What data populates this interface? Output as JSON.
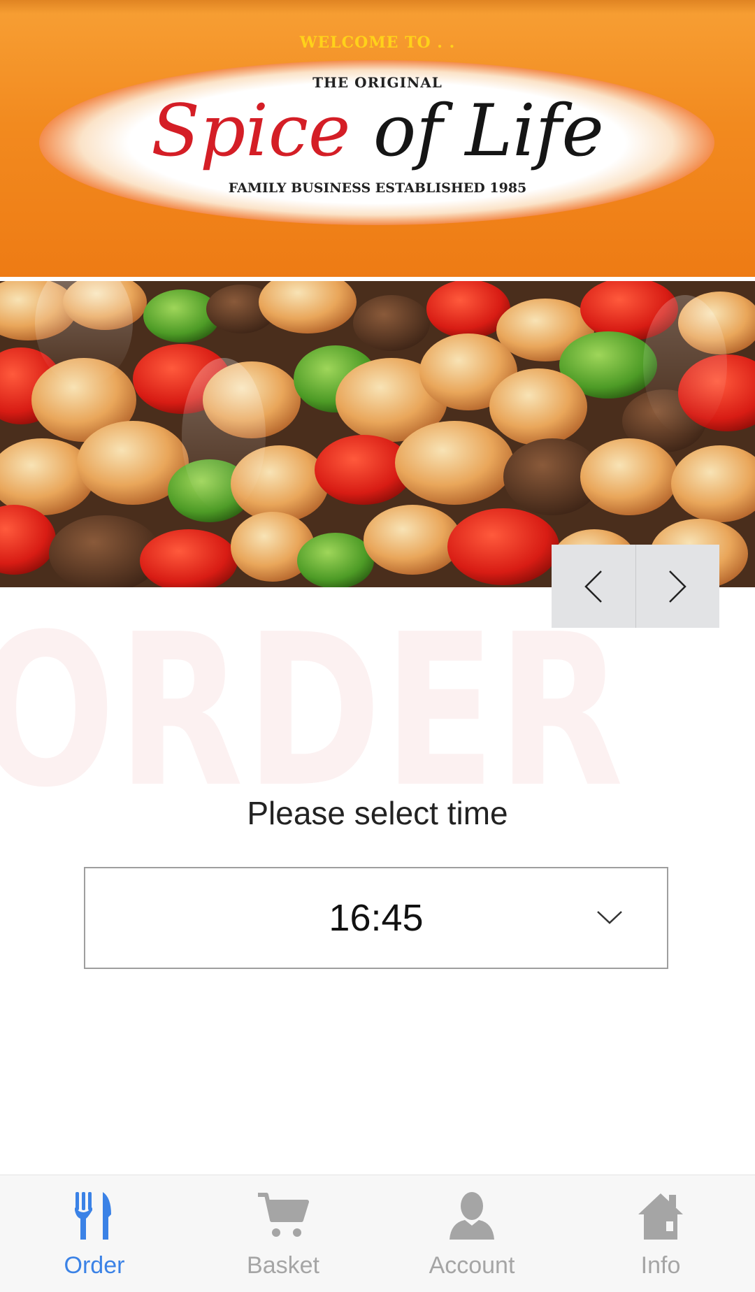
{
  "header": {
    "welcome": "WELCOME TO . .",
    "logo_original": "THE ORIGINAL",
    "logo_title_part1": "Spice",
    "logo_title_part2": " of Life",
    "logo_tagline": "FAMILY BUSINESS ESTABLISHED 1985"
  },
  "banner": {
    "description_icon": "food-kebab-image",
    "prev_icon": "chevron-left-icon",
    "next_icon": "chevron-right-icon"
  },
  "order": {
    "watermark": "ORDER",
    "select_label": "Please select time",
    "time_value": "16:45",
    "dropdown_icon": "chevron-down-icon"
  },
  "nav": {
    "items": [
      {
        "label": "Order",
        "icon": "fork-knife-icon",
        "active": true
      },
      {
        "label": "Basket",
        "icon": "cart-icon",
        "active": false
      },
      {
        "label": "Account",
        "icon": "user-icon",
        "active": false
      },
      {
        "label": "Info",
        "icon": "home-icon",
        "active": false
      }
    ]
  },
  "colors": {
    "accent": "#3b82e6",
    "inactive": "#a5a5a5",
    "header_orange": "#f28a1f",
    "logo_red": "#d41e26"
  }
}
